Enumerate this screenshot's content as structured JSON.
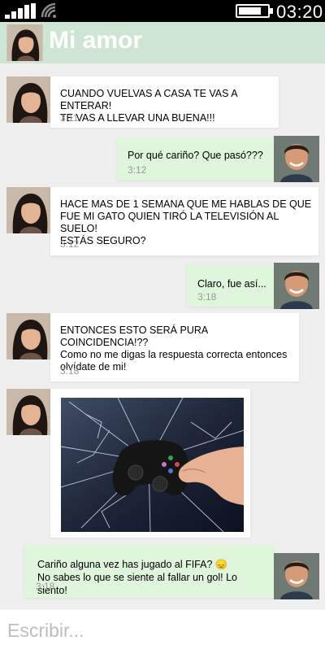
{
  "status_bar": {
    "time": "03:20",
    "signal_icon": "cell-signal-icon",
    "wifi_icon": "wifi-icon",
    "battery_icon": "battery-icon"
  },
  "header": {
    "title": "Mi amor",
    "avatar": "contact-avatar"
  },
  "messages": [
    {
      "sender": "contact",
      "text": "CUANDO VUELVAS A CASA TE VAS A ENTERAR!\nTE VAS A LLEVAR UNA BUENA!!!",
      "time": "3:11"
    },
    {
      "sender": "me",
      "text": "Por qué cariño? Que pasó???",
      "time": "3:12"
    },
    {
      "sender": "contact",
      "text": "HACE MAS DE 1 SEMANA QUE ME HABLAS DE QUE\nFUE MI GATO QUIEN TIRÓ LA TELEVISIÓN AL SUELO!\nESTÁS SEGURO?",
      "time": "3:12"
    },
    {
      "sender": "me",
      "text": "Claro, fue así...",
      "time": "3:18"
    },
    {
      "sender": "contact",
      "text": "ENTONCES ESTO SERÁ PURA COINCIDENCIA!??\nComo no me digas la respuesta correcta entonces\nolvídate de mi!",
      "time": "3:18"
    },
    {
      "sender": "contact",
      "image": "broken-tv-with-game-controller"
    },
    {
      "sender": "me",
      "text": "Cariño alguna vez has jugado al FIFA? 😞\nNo sabes lo que se siente al fallar un gol! Lo siento!",
      "time": "3:18"
    }
  ],
  "composer": {
    "placeholder": "Escribir..."
  },
  "colors": {
    "header": "#cfe5d4",
    "outgoing_bubble": "#dff5dc",
    "incoming_bubble": "#ffffff",
    "background": "#efefef"
  }
}
